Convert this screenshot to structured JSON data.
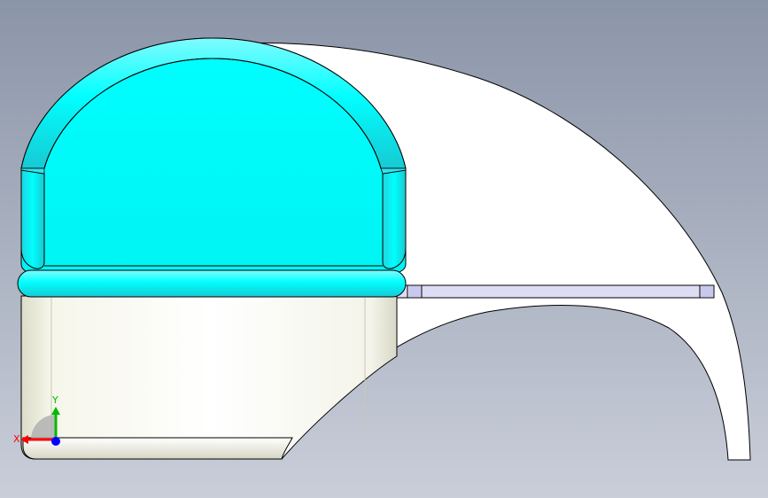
{
  "viewport": {
    "background_top": "#8b95a8",
    "background_bottom": "#c9ced9"
  },
  "model": {
    "body_color": "#ffffff",
    "body_shadow_color": "#e8e8d8",
    "cap_color": "#00ffff",
    "cap_shade_color": "#2fd6dd",
    "rail_color": "#dcdcf4",
    "edge_color": "#000000"
  },
  "triad": {
    "x_label": "X",
    "y_label": "Y",
    "x_color": "#ff0000",
    "y_color": "#00bb00",
    "z_color": "#0000ff"
  }
}
